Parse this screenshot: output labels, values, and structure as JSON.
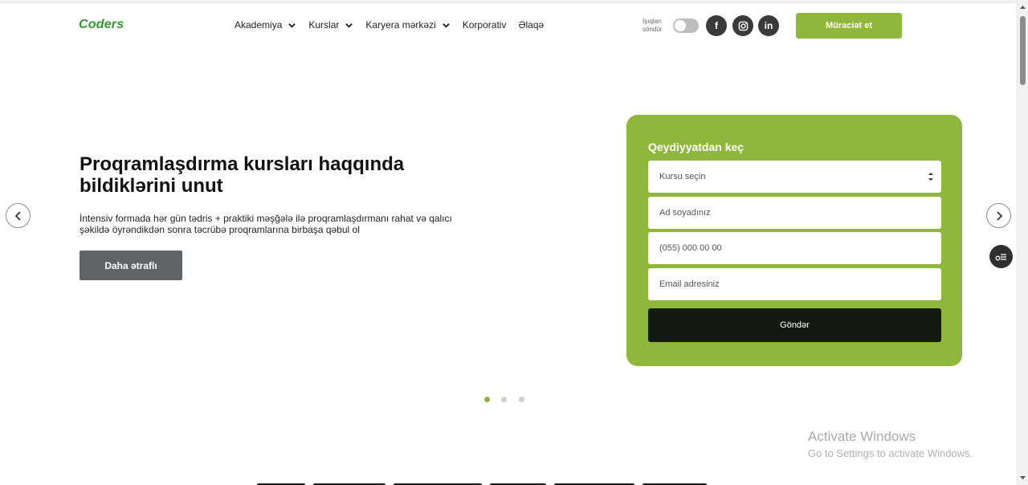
{
  "header": {
    "logo": "Coders",
    "nav": [
      {
        "label": "Akademiya",
        "dropdown": true
      },
      {
        "label": "Kurslar",
        "dropdown": true
      },
      {
        "label": "Karyera mərkəzi",
        "dropdown": true
      },
      {
        "label": "Korporativ",
        "dropdown": false
      },
      {
        "label": "Əlaqə",
        "dropdown": false
      }
    ],
    "lights_label_line1": "İşıqları",
    "lights_label_line2": "söndür",
    "social": [
      {
        "name": "facebook-icon",
        "glyph": "f"
      },
      {
        "name": "instagram-icon",
        "glyph": ""
      },
      {
        "name": "linkedin-icon",
        "glyph": "in"
      }
    ],
    "apply_label": "Müraciət et"
  },
  "hero": {
    "title": "Proqramlaşdırma kursları haqqında bildiklərini unut",
    "description": "İntensiv formada hər gün tədris + praktiki məşğələ ilə proqramlaşdırmanı rahat və qalıcı şəkildə öyrəndikdən sonra təcrübə proqramlarına birbaşa qəbul ol",
    "more_label": "Daha ətraflı"
  },
  "form": {
    "title": "Qeydiyyatdan keç",
    "course_select": "Kursu seçin",
    "name_placeholder": "Ad soyadınız",
    "phone_placeholder": "(055) 000 00 00",
    "email_placeholder": "Email adresiniz",
    "submit_label": "Göndər"
  },
  "carousel": {
    "slides": 3,
    "active": 0
  },
  "watermark": {
    "line1": "Activate Windows",
    "line2": "Go to Settings to activate Windows."
  },
  "colors": {
    "accent": "#8fb73b",
    "logo": "#2f9a2c",
    "dark_button": "#141a0f"
  }
}
